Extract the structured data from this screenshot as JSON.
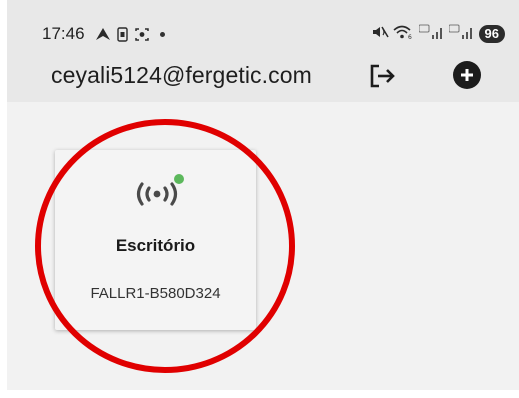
{
  "status_bar": {
    "time": "17:46",
    "battery": "96",
    "icons_left": [
      "navigation-icon",
      "sim-icon",
      "screen-record-icon",
      "notification-dot"
    ],
    "icons_right": [
      "mute-icon",
      "wifi-icon",
      "signal-5g-icon-1",
      "signal-5g-icon-2"
    ]
  },
  "header": {
    "account_email": "ceyali5124@fergetic.com",
    "logout_icon": "logout-icon",
    "add_icon": "add-circle-icon"
  },
  "devices": [
    {
      "name": "Escritório",
      "id": "FALLR1-B580D324",
      "icon": "broadcast-icon",
      "online": true,
      "status_color": "#5cb85c"
    }
  ],
  "annotation": {
    "color": "#e00000"
  }
}
